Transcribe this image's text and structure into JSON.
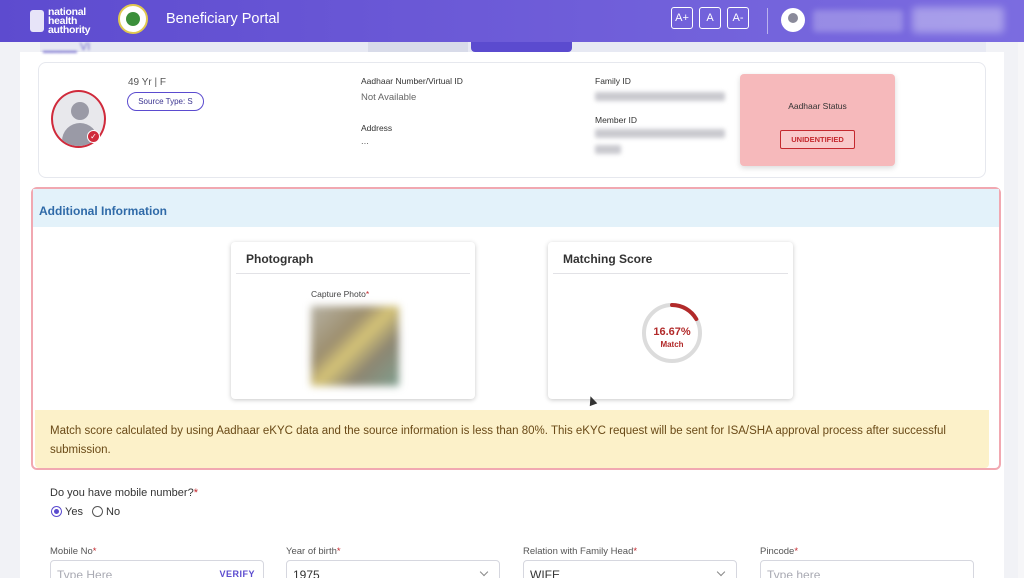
{
  "header": {
    "logo_lines": [
      "national",
      "health",
      "authority"
    ],
    "portal_title": "Beneficiary Portal",
    "font_controls": [
      "A+",
      "A",
      "A-"
    ]
  },
  "beneficiary": {
    "age_gender": "49 Yr | F",
    "source_type": "Source Type: S",
    "aadhaar_label": "Aadhaar Number/Virtual ID",
    "aadhaar_value": "Not Available",
    "address_label": "Address",
    "address_value": "...",
    "family_id_label": "Family ID",
    "member_id_label": "Member ID",
    "aadhaar_status_label": "Aadhaar Status",
    "aadhaar_status_value": "UNIDENTIFIED"
  },
  "additional": {
    "title": "Additional Information",
    "photograph_title": "Photograph",
    "capture_label": "Capture Photo",
    "matching_title": "Matching Score",
    "score_pct": "16.67%",
    "score_match": "Match",
    "score_fraction": 0.1667,
    "warning": "Match score calculated by using Aadhaar eKYC data and the source information is less than 80%. This eKYC request will be sent for ISA/SHA approval process after successful submission."
  },
  "form": {
    "mobile_question": "Do you have mobile number?",
    "radio_yes": "Yes",
    "radio_no": "No",
    "mobile_label": "Mobile No",
    "mobile_placeholder": "Type Here",
    "verify_label": "VERIFY",
    "yob_label": "Year of birth",
    "yob_value": "1975",
    "relation_label": "Relation with Family Head",
    "relation_value": "WIFE",
    "pincode_label": "Pincode",
    "pincode_placeholder": "Type here"
  },
  "colors": {
    "header": "#6a58d6",
    "accent": "#5b4bcf",
    "danger": "#c4282e",
    "info_header": "#e3f2fa",
    "warning_bg": "#fcf1c9"
  }
}
